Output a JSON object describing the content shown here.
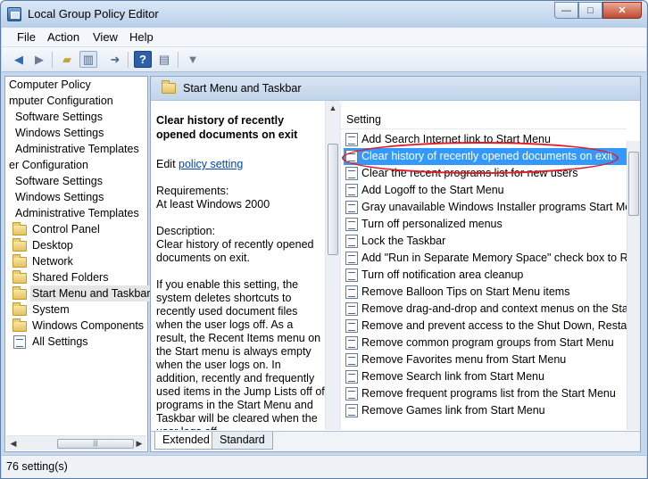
{
  "window": {
    "title": "Local Group Policy Editor",
    "controls": {
      "minimize": "—",
      "maximize": "□",
      "close": "✕"
    }
  },
  "menu": [
    "File",
    "Action",
    "View",
    "Help"
  ],
  "toolbar": {
    "buttons": [
      "back-arrow-icon",
      "forward-arrow-icon",
      "up-folder-icon",
      "show-hide-tree-icon",
      "export-list-icon",
      "help-icon",
      "properties-icon",
      "filter-icon"
    ]
  },
  "tree": {
    "items": [
      "Computer Policy",
      "mputer Configuration",
      "Software Settings",
      "Windows Settings",
      "Administrative Templates",
      "er Configuration",
      "Software Settings",
      "Windows Settings",
      "Administrative Templates",
      "Control Panel",
      "Desktop",
      "Network",
      "Shared Folders",
      "Start Menu and Taskbar",
      "System",
      "Windows Components",
      "All Settings"
    ],
    "selected": "Start Menu and Taskbar",
    "scroll_grip": "|||"
  },
  "header": {
    "title": "Start Menu and Taskbar"
  },
  "description": {
    "title": "Clear history of recently opened documents on exit",
    "edit_prefix": "Edit ",
    "edit_link": "policy setting",
    "requirements_label": "Requirements:",
    "requirements_value": "At least Windows 2000",
    "description_label": "Description:",
    "description_value": "Clear history of recently opened documents on exit.",
    "body": "If you enable this setting, the system deletes shortcuts to recently used document files when the user logs off. As a result, the Recent Items menu on the Start menu is always empty when the user logs on. In addition, recently and frequently used items in the Jump Lists off of programs in the Start Menu and Taskbar will be cleared when the user logs off."
  },
  "list": {
    "column_header": "Setting",
    "selected_index": 1,
    "rows": [
      "Add Search Internet link to Start Menu",
      "Clear history of recently opened documents on exit",
      "Clear the recent programs list for new users",
      "Add Logoff to the Start Menu",
      "Gray unavailable Windows Installer programs Start Menu",
      "Turn off personalized menus",
      "Lock the Taskbar",
      "Add \"Run in Separate Memory Space\" check box to Run",
      "Turn off notification area cleanup",
      "Remove Balloon Tips on Start Menu items",
      "Remove drag-and-drop and context menus on the Start",
      "Remove and prevent access to the Shut Down, Restart, S",
      "Remove common program groups from Start Menu",
      "Remove Favorites menu from Start Menu",
      "Remove Search link from Start Menu",
      "Remove frequent programs list from the Start Menu",
      "Remove Games link from Start Menu"
    ]
  },
  "tabs": [
    "Extended",
    "Standard"
  ],
  "status": {
    "text": "76 setting(s)"
  },
  "colors": {
    "selection": "#3399ff",
    "highlight_oval": "#e21c24",
    "link": "#0645ad"
  }
}
